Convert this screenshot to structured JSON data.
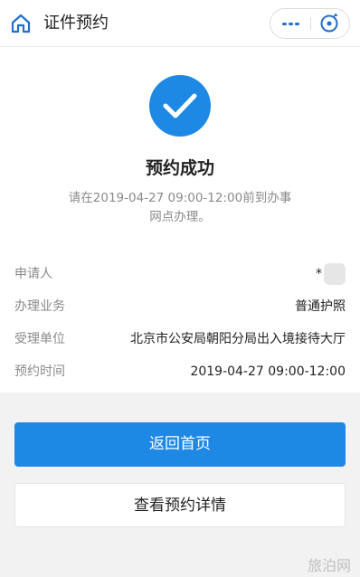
{
  "header": {
    "title": "证件预约",
    "icons": {
      "home": "home-icon",
      "more": "more-dots-icon",
      "close": "close-target-icon"
    },
    "accent_color": "#1f6fd1"
  },
  "result": {
    "icon": "checkmark-icon",
    "title": "预约成功",
    "description": "请在2019-04-27 09:00-12:00前到办事网点办理。",
    "color": "#1e88e5"
  },
  "details": [
    {
      "label": "申请人",
      "value": "*"
    },
    {
      "label": "办理业务",
      "value": "普通护照"
    },
    {
      "label": "受理单位",
      "value": "北京市公安局朝阳分局出入境接待大厅"
    },
    {
      "label": "预约时间",
      "value": "2019-04-27 09:00-12:00"
    }
  ],
  "actions": {
    "home_label": "返回首页",
    "detail_label": "查看预约详情"
  },
  "watermark": "旅泊网"
}
